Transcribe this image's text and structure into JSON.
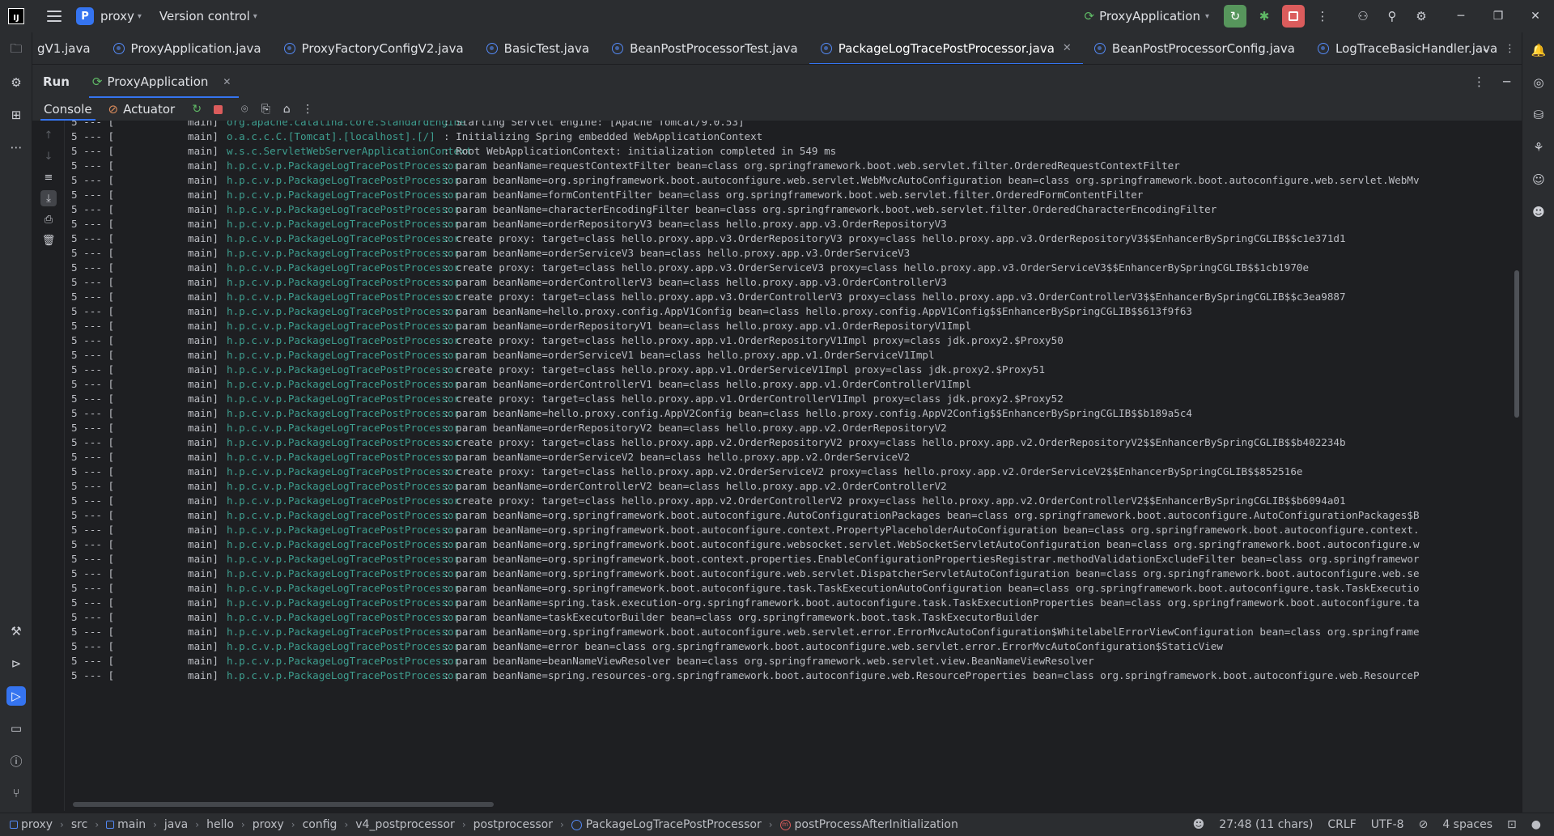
{
  "titlebar": {
    "project_initial": "P",
    "project_name": "proxy",
    "vcs_label": "Version control",
    "run_config": "ProxyApplication"
  },
  "editor_tabs": [
    {
      "label": "gV1.java",
      "active": false
    },
    {
      "label": "ProxyApplication.java",
      "active": false
    },
    {
      "label": "ProxyFactoryConfigV2.java",
      "active": false
    },
    {
      "label": "BasicTest.java",
      "active": false
    },
    {
      "label": "BeanPostProcessorTest.java",
      "active": false
    },
    {
      "label": "PackageLogTracePostProcessor.java",
      "active": true
    },
    {
      "label": "BeanPostProcessorConfig.java",
      "active": false
    },
    {
      "label": "LogTraceBasicHandler.java",
      "active": false
    }
  ],
  "run_window": {
    "title": "Run",
    "tab_label": "ProxyApplication",
    "console_tab": "Console",
    "actuator_tab": "Actuator"
  },
  "console_lines": [
    {
      "lvl": "5 --- [",
      "thread": "main]",
      "logger": "org.apache.catalina.core.StandardEngine",
      "msg": ": Starting Servlet engine: [Apache Tomcat/9.0.53]"
    },
    {
      "lvl": "5 --- [",
      "thread": "main]",
      "logger": "o.a.c.c.C.[Tomcat].[localhost].[/]",
      "msg": ": Initializing Spring embedded WebApplicationContext"
    },
    {
      "lvl": "5 --- [",
      "thread": "main]",
      "logger": "w.s.c.ServletWebServerApplicationContext",
      "msg": ": Root WebApplicationContext: initialization completed in 549 ms"
    },
    {
      "lvl": "5 --- [",
      "thread": "main]",
      "logger": "h.p.c.v.p.PackageLogTracePostProcessor",
      "msg": ": param beanName=requestContextFilter bean=class org.springframework.boot.web.servlet.filter.OrderedRequestContextFilter"
    },
    {
      "lvl": "5 --- [",
      "thread": "main]",
      "logger": "h.p.c.v.p.PackageLogTracePostProcessor",
      "msg": ": param beanName=org.springframework.boot.autoconfigure.web.servlet.WebMvcAutoConfiguration bean=class org.springframework.boot.autoconfigure.web.servlet.WebMv"
    },
    {
      "lvl": "5 --- [",
      "thread": "main]",
      "logger": "h.p.c.v.p.PackageLogTracePostProcessor",
      "msg": ": param beanName=formContentFilter bean=class org.springframework.boot.web.servlet.filter.OrderedFormContentFilter"
    },
    {
      "lvl": "5 --- [",
      "thread": "main]",
      "logger": "h.p.c.v.p.PackageLogTracePostProcessor",
      "msg": ": param beanName=characterEncodingFilter bean=class org.springframework.boot.web.servlet.filter.OrderedCharacterEncodingFilter"
    },
    {
      "lvl": "5 --- [",
      "thread": "main]",
      "logger": "h.p.c.v.p.PackageLogTracePostProcessor",
      "msg": ": param beanName=orderRepositoryV3 bean=class hello.proxy.app.v3.OrderRepositoryV3"
    },
    {
      "lvl": "5 --- [",
      "thread": "main]",
      "logger": "h.p.c.v.p.PackageLogTracePostProcessor",
      "msg": ": create proxy: target=class hello.proxy.app.v3.OrderRepositoryV3 proxy=class hello.proxy.app.v3.OrderRepositoryV3$$EnhancerBySpringCGLIB$$c1e371d1"
    },
    {
      "lvl": "5 --- [",
      "thread": "main]",
      "logger": "h.p.c.v.p.PackageLogTracePostProcessor",
      "msg": ": param beanName=orderServiceV3 bean=class hello.proxy.app.v3.OrderServiceV3"
    },
    {
      "lvl": "5 --- [",
      "thread": "main]",
      "logger": "h.p.c.v.p.PackageLogTracePostProcessor",
      "msg": ": create proxy: target=class hello.proxy.app.v3.OrderServiceV3 proxy=class hello.proxy.app.v3.OrderServiceV3$$EnhancerBySpringCGLIB$$1cb1970e"
    },
    {
      "lvl": "5 --- [",
      "thread": "main]",
      "logger": "h.p.c.v.p.PackageLogTracePostProcessor",
      "msg": ": param beanName=orderControllerV3 bean=class hello.proxy.app.v3.OrderControllerV3"
    },
    {
      "lvl": "5 --- [",
      "thread": "main]",
      "logger": "h.p.c.v.p.PackageLogTracePostProcessor",
      "msg": ": create proxy: target=class hello.proxy.app.v3.OrderControllerV3 proxy=class hello.proxy.app.v3.OrderControllerV3$$EnhancerBySpringCGLIB$$c3ea9887"
    },
    {
      "lvl": "5 --- [",
      "thread": "main]",
      "logger": "h.p.c.v.p.PackageLogTracePostProcessor",
      "msg": ": param beanName=hello.proxy.config.AppV1Config bean=class hello.proxy.config.AppV1Config$$EnhancerBySpringCGLIB$$613f9f63"
    },
    {
      "lvl": "5 --- [",
      "thread": "main]",
      "logger": "h.p.c.v.p.PackageLogTracePostProcessor",
      "msg": ": param beanName=orderRepositoryV1 bean=class hello.proxy.app.v1.OrderRepositoryV1Impl"
    },
    {
      "lvl": "5 --- [",
      "thread": "main]",
      "logger": "h.p.c.v.p.PackageLogTracePostProcessor",
      "msg": ": create proxy: target=class hello.proxy.app.v1.OrderRepositoryV1Impl proxy=class jdk.proxy2.$Proxy50"
    },
    {
      "lvl": "5 --- [",
      "thread": "main]",
      "logger": "h.p.c.v.p.PackageLogTracePostProcessor",
      "msg": ": param beanName=orderServiceV1 bean=class hello.proxy.app.v1.OrderServiceV1Impl"
    },
    {
      "lvl": "5 --- [",
      "thread": "main]",
      "logger": "h.p.c.v.p.PackageLogTracePostProcessor",
      "msg": ": create proxy: target=class hello.proxy.app.v1.OrderServiceV1Impl proxy=class jdk.proxy2.$Proxy51"
    },
    {
      "lvl": "5 --- [",
      "thread": "main]",
      "logger": "h.p.c.v.p.PackageLogTracePostProcessor",
      "msg": ": param beanName=orderControllerV1 bean=class hello.proxy.app.v1.OrderControllerV1Impl"
    },
    {
      "lvl": "5 --- [",
      "thread": "main]",
      "logger": "h.p.c.v.p.PackageLogTracePostProcessor",
      "msg": ": create proxy: target=class hello.proxy.app.v1.OrderControllerV1Impl proxy=class jdk.proxy2.$Proxy52"
    },
    {
      "lvl": "5 --- [",
      "thread": "main]",
      "logger": "h.p.c.v.p.PackageLogTracePostProcessor",
      "msg": ": param beanName=hello.proxy.config.AppV2Config bean=class hello.proxy.config.AppV2Config$$EnhancerBySpringCGLIB$$b189a5c4"
    },
    {
      "lvl": "5 --- [",
      "thread": "main]",
      "logger": "h.p.c.v.p.PackageLogTracePostProcessor",
      "msg": ": param beanName=orderRepositoryV2 bean=class hello.proxy.app.v2.OrderRepositoryV2"
    },
    {
      "lvl": "5 --- [",
      "thread": "main]",
      "logger": "h.p.c.v.p.PackageLogTracePostProcessor",
      "msg": ": create proxy: target=class hello.proxy.app.v2.OrderRepositoryV2 proxy=class hello.proxy.app.v2.OrderRepositoryV2$$EnhancerBySpringCGLIB$$b402234b"
    },
    {
      "lvl": "5 --- [",
      "thread": "main]",
      "logger": "h.p.c.v.p.PackageLogTracePostProcessor",
      "msg": ": param beanName=orderServiceV2 bean=class hello.proxy.app.v2.OrderServiceV2"
    },
    {
      "lvl": "5 --- [",
      "thread": "main]",
      "logger": "h.p.c.v.p.PackageLogTracePostProcessor",
      "msg": ": create proxy: target=class hello.proxy.app.v2.OrderServiceV2 proxy=class hello.proxy.app.v2.OrderServiceV2$$EnhancerBySpringCGLIB$$852516e"
    },
    {
      "lvl": "5 --- [",
      "thread": "main]",
      "logger": "h.p.c.v.p.PackageLogTracePostProcessor",
      "msg": ": param beanName=orderControllerV2 bean=class hello.proxy.app.v2.OrderControllerV2"
    },
    {
      "lvl": "5 --- [",
      "thread": "main]",
      "logger": "h.p.c.v.p.PackageLogTracePostProcessor",
      "msg": ": create proxy: target=class hello.proxy.app.v2.OrderControllerV2 proxy=class hello.proxy.app.v2.OrderControllerV2$$EnhancerBySpringCGLIB$$b6094a01"
    },
    {
      "lvl": "5 --- [",
      "thread": "main]",
      "logger": "h.p.c.v.p.PackageLogTracePostProcessor",
      "msg": ": param beanName=org.springframework.boot.autoconfigure.AutoConfigurationPackages bean=class org.springframework.boot.autoconfigure.AutoConfigurationPackages$B"
    },
    {
      "lvl": "5 --- [",
      "thread": "main]",
      "logger": "h.p.c.v.p.PackageLogTracePostProcessor",
      "msg": ": param beanName=org.springframework.boot.autoconfigure.context.PropertyPlaceholderAutoConfiguration bean=class org.springframework.boot.autoconfigure.context."
    },
    {
      "lvl": "5 --- [",
      "thread": "main]",
      "logger": "h.p.c.v.p.PackageLogTracePostProcessor",
      "msg": ": param beanName=org.springframework.boot.autoconfigure.websocket.servlet.WebSocketServletAutoConfiguration bean=class org.springframework.boot.autoconfigure.w"
    },
    {
      "lvl": "5 --- [",
      "thread": "main]",
      "logger": "h.p.c.v.p.PackageLogTracePostProcessor",
      "msg": ": param beanName=org.springframework.boot.context.properties.EnableConfigurationPropertiesRegistrar.methodValidationExcludeFilter bean=class org.springframewor"
    },
    {
      "lvl": "5 --- [",
      "thread": "main]",
      "logger": "h.p.c.v.p.PackageLogTracePostProcessor",
      "msg": ": param beanName=org.springframework.boot.autoconfigure.web.servlet.DispatcherServletAutoConfiguration bean=class org.springframework.boot.autoconfigure.web.se"
    },
    {
      "lvl": "5 --- [",
      "thread": "main]",
      "logger": "h.p.c.v.p.PackageLogTracePostProcessor",
      "msg": ": param beanName=org.springframework.boot.autoconfigure.task.TaskExecutionAutoConfiguration bean=class org.springframework.boot.autoconfigure.task.TaskExecutio"
    },
    {
      "lvl": "5 --- [",
      "thread": "main]",
      "logger": "h.p.c.v.p.PackageLogTracePostProcessor",
      "msg": ": param beanName=spring.task.execution-org.springframework.boot.autoconfigure.task.TaskExecutionProperties bean=class org.springframework.boot.autoconfigure.ta"
    },
    {
      "lvl": "5 --- [",
      "thread": "main]",
      "logger": "h.p.c.v.p.PackageLogTracePostProcessor",
      "msg": ": param beanName=taskExecutorBuilder bean=class org.springframework.boot.task.TaskExecutorBuilder"
    },
    {
      "lvl": "5 --- [",
      "thread": "main]",
      "logger": "h.p.c.v.p.PackageLogTracePostProcessor",
      "msg": ": param beanName=org.springframework.boot.autoconfigure.web.servlet.error.ErrorMvcAutoConfiguration$WhitelabelErrorViewConfiguration bean=class org.springframe"
    },
    {
      "lvl": "5 --- [",
      "thread": "main]",
      "logger": "h.p.c.v.p.PackageLogTracePostProcessor",
      "msg": ": param beanName=error bean=class org.springframework.boot.autoconfigure.web.servlet.error.ErrorMvcAutoConfiguration$StaticView"
    },
    {
      "lvl": "5 --- [",
      "thread": "main]",
      "logger": "h.p.c.v.p.PackageLogTracePostProcessor",
      "msg": ": param beanName=beanNameViewResolver bean=class org.springframework.web.servlet.view.BeanNameViewResolver"
    },
    {
      "lvl": "5 --- [",
      "thread": "main]",
      "logger": "h.p.c.v.p.PackageLogTracePostProcessor",
      "msg": ": param beanName=spring.resources-org.springframework.boot.autoconfigure.web.ResourceProperties bean=class org.springframework.boot.autoconfigure.web.ResourceP"
    }
  ],
  "breadcrumb": {
    "items": [
      "proxy",
      "src",
      "main",
      "java",
      "hello",
      "proxy",
      "config",
      "v4_postprocessor",
      "postprocessor",
      "PackageLogTracePostProcessor",
      "postProcessAfterInitialization"
    ]
  },
  "status": {
    "position": "27:48 (11 chars)",
    "line_sep": "CRLF",
    "encoding": "UTF-8",
    "indent": "4 spaces"
  },
  "colors": {
    "accent": "#3574f0",
    "logger": "#3e9e8f",
    "run_green": "#57965c",
    "stop_red": "#db5c5c"
  }
}
